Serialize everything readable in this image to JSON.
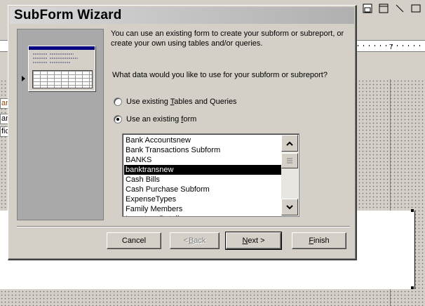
{
  "dialog": {
    "title": "SubForm Wizard",
    "intro_line1": "You can use an existing form to create your subform or subreport, or",
    "intro_line2": "create your own using tables and/or queries.",
    "question": "What data would you like to use for your subform or subreport?"
  },
  "options": {
    "tables_label_pre": "Use existing ",
    "tables_label_key": "T",
    "tables_label_post": "ables and Queries",
    "form_label_pre": "Use an existing ",
    "form_label_key": "f",
    "form_label_post": "orm",
    "selected": "form"
  },
  "forms_list": {
    "items": [
      "Bank Accountsnew",
      "Bank Transactions Subform",
      "BANKS",
      "banktransnew",
      "Cash Bills",
      "Cash Purchase Subform",
      "ExpenseTypes",
      "Family Members",
      "Inventory Details"
    ],
    "selected_item": "banktransnew"
  },
  "buttons": {
    "cancel": "Cancel",
    "back_key": "B",
    "back_rest": "ack",
    "back_prefix": "< ",
    "next_key": "N",
    "next_rest": "ext >",
    "finish_key": "F",
    "finish_rest": "inish"
  },
  "background": {
    "ruler_mark": "7",
    "cut_labels": [
      "an",
      "an",
      "fic"
    ]
  },
  "colors": {
    "selection": "#000000",
    "dialog_face": "#d4d0c8",
    "title_gradient": "#b0b0b0"
  }
}
